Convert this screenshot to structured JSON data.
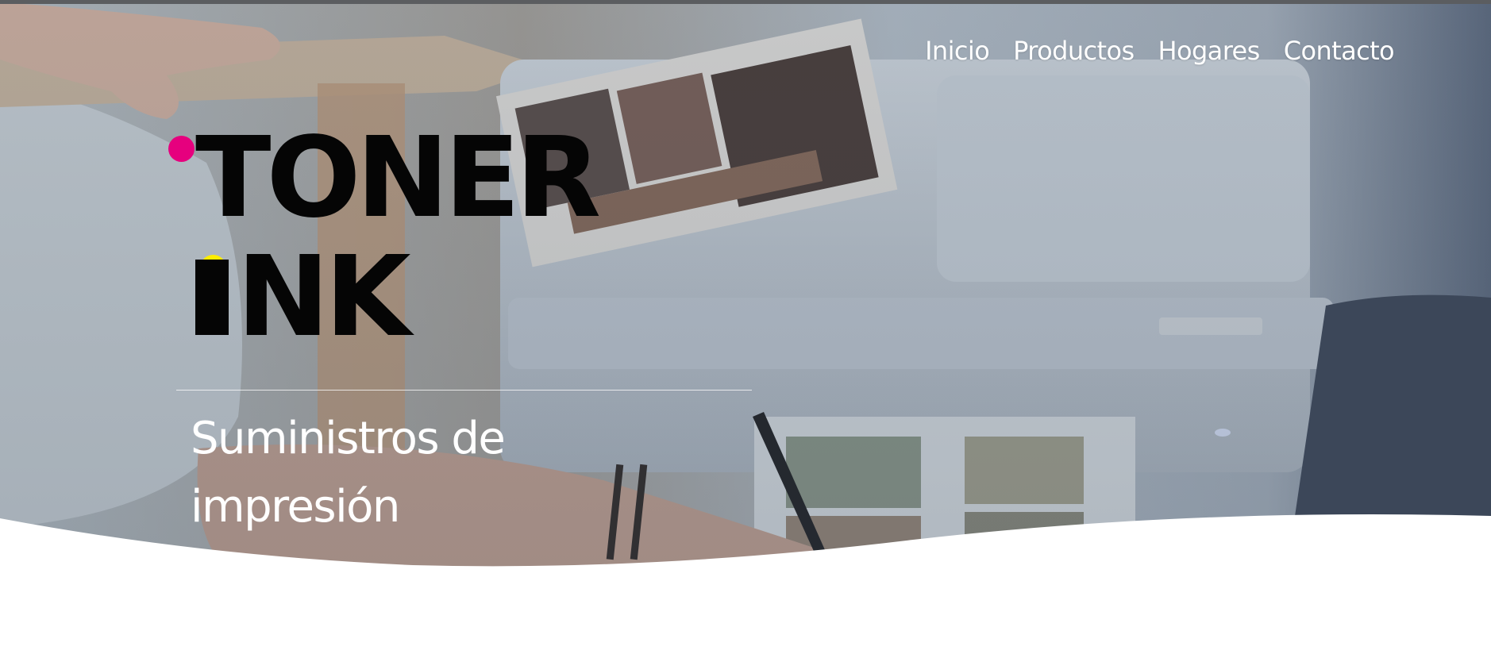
{
  "nav": {
    "items": [
      {
        "label": "Inicio"
      },
      {
        "label": "Productos"
      },
      {
        "label": "Hogares"
      },
      {
        "label": "Contacto"
      }
    ]
  },
  "logo": {
    "line1": "TONER",
    "line2": "NK",
    "colors": {
      "magenta": "#e6007e",
      "yellow": "#ffed00",
      "black": "#050505"
    }
  },
  "hero": {
    "tagline": "Suministros de impresión"
  },
  "colors": {
    "text_light": "#ffffff",
    "page_bg": "#ffffff"
  }
}
